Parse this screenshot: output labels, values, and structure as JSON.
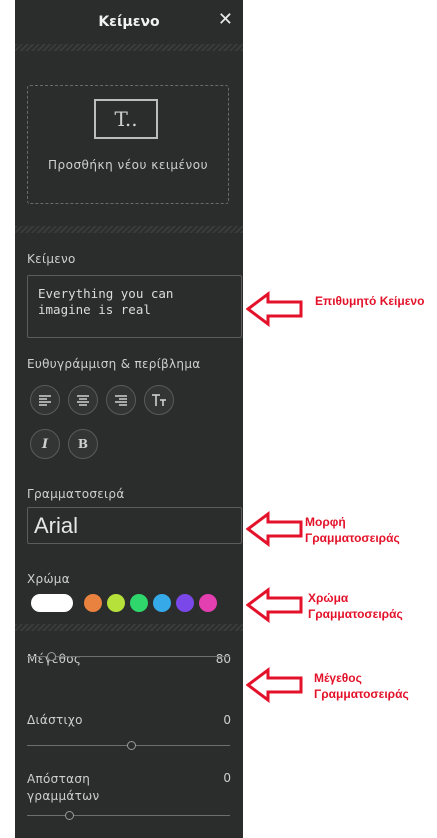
{
  "panel": {
    "title": "Κείμενο",
    "close_glyph": "✕",
    "add_text_label": "Προσθήκη νέου κειμένου",
    "add_text_icon_glyph": "T..",
    "text_section_label": "Κείμενο",
    "text_value": "Everything you can imagine is real",
    "alignment_label": "Ευθυγράμμιση & περίβλημα",
    "italic_glyph": "I",
    "bold_glyph": "B",
    "font_label": "Γραμματοσειρά",
    "font_value": "Arial",
    "color_label": "Χρώμα",
    "colors": [
      "#ffffff",
      "#e8823e",
      "#b6e03a",
      "#2ed66b",
      "#36a9e8",
      "#7a48e8",
      "#e33fb0"
    ],
    "size_label": "Μέγεθος",
    "size_value": "80",
    "line_spacing_label": "Διάστιχο",
    "line_spacing_value": "0",
    "letter_spacing_label": "Απόσταση γραμμάτων",
    "letter_spacing_value": "0"
  },
  "annotations": {
    "text": "Επιθυμητό Κείμενο",
    "font": "Μορφή Γραμματοσειράς",
    "color": "Χρώμα Γραμματοσειράς",
    "size": "Μέγεθος Γραμματοσειράς",
    "arrow_color": "#e3122a"
  }
}
